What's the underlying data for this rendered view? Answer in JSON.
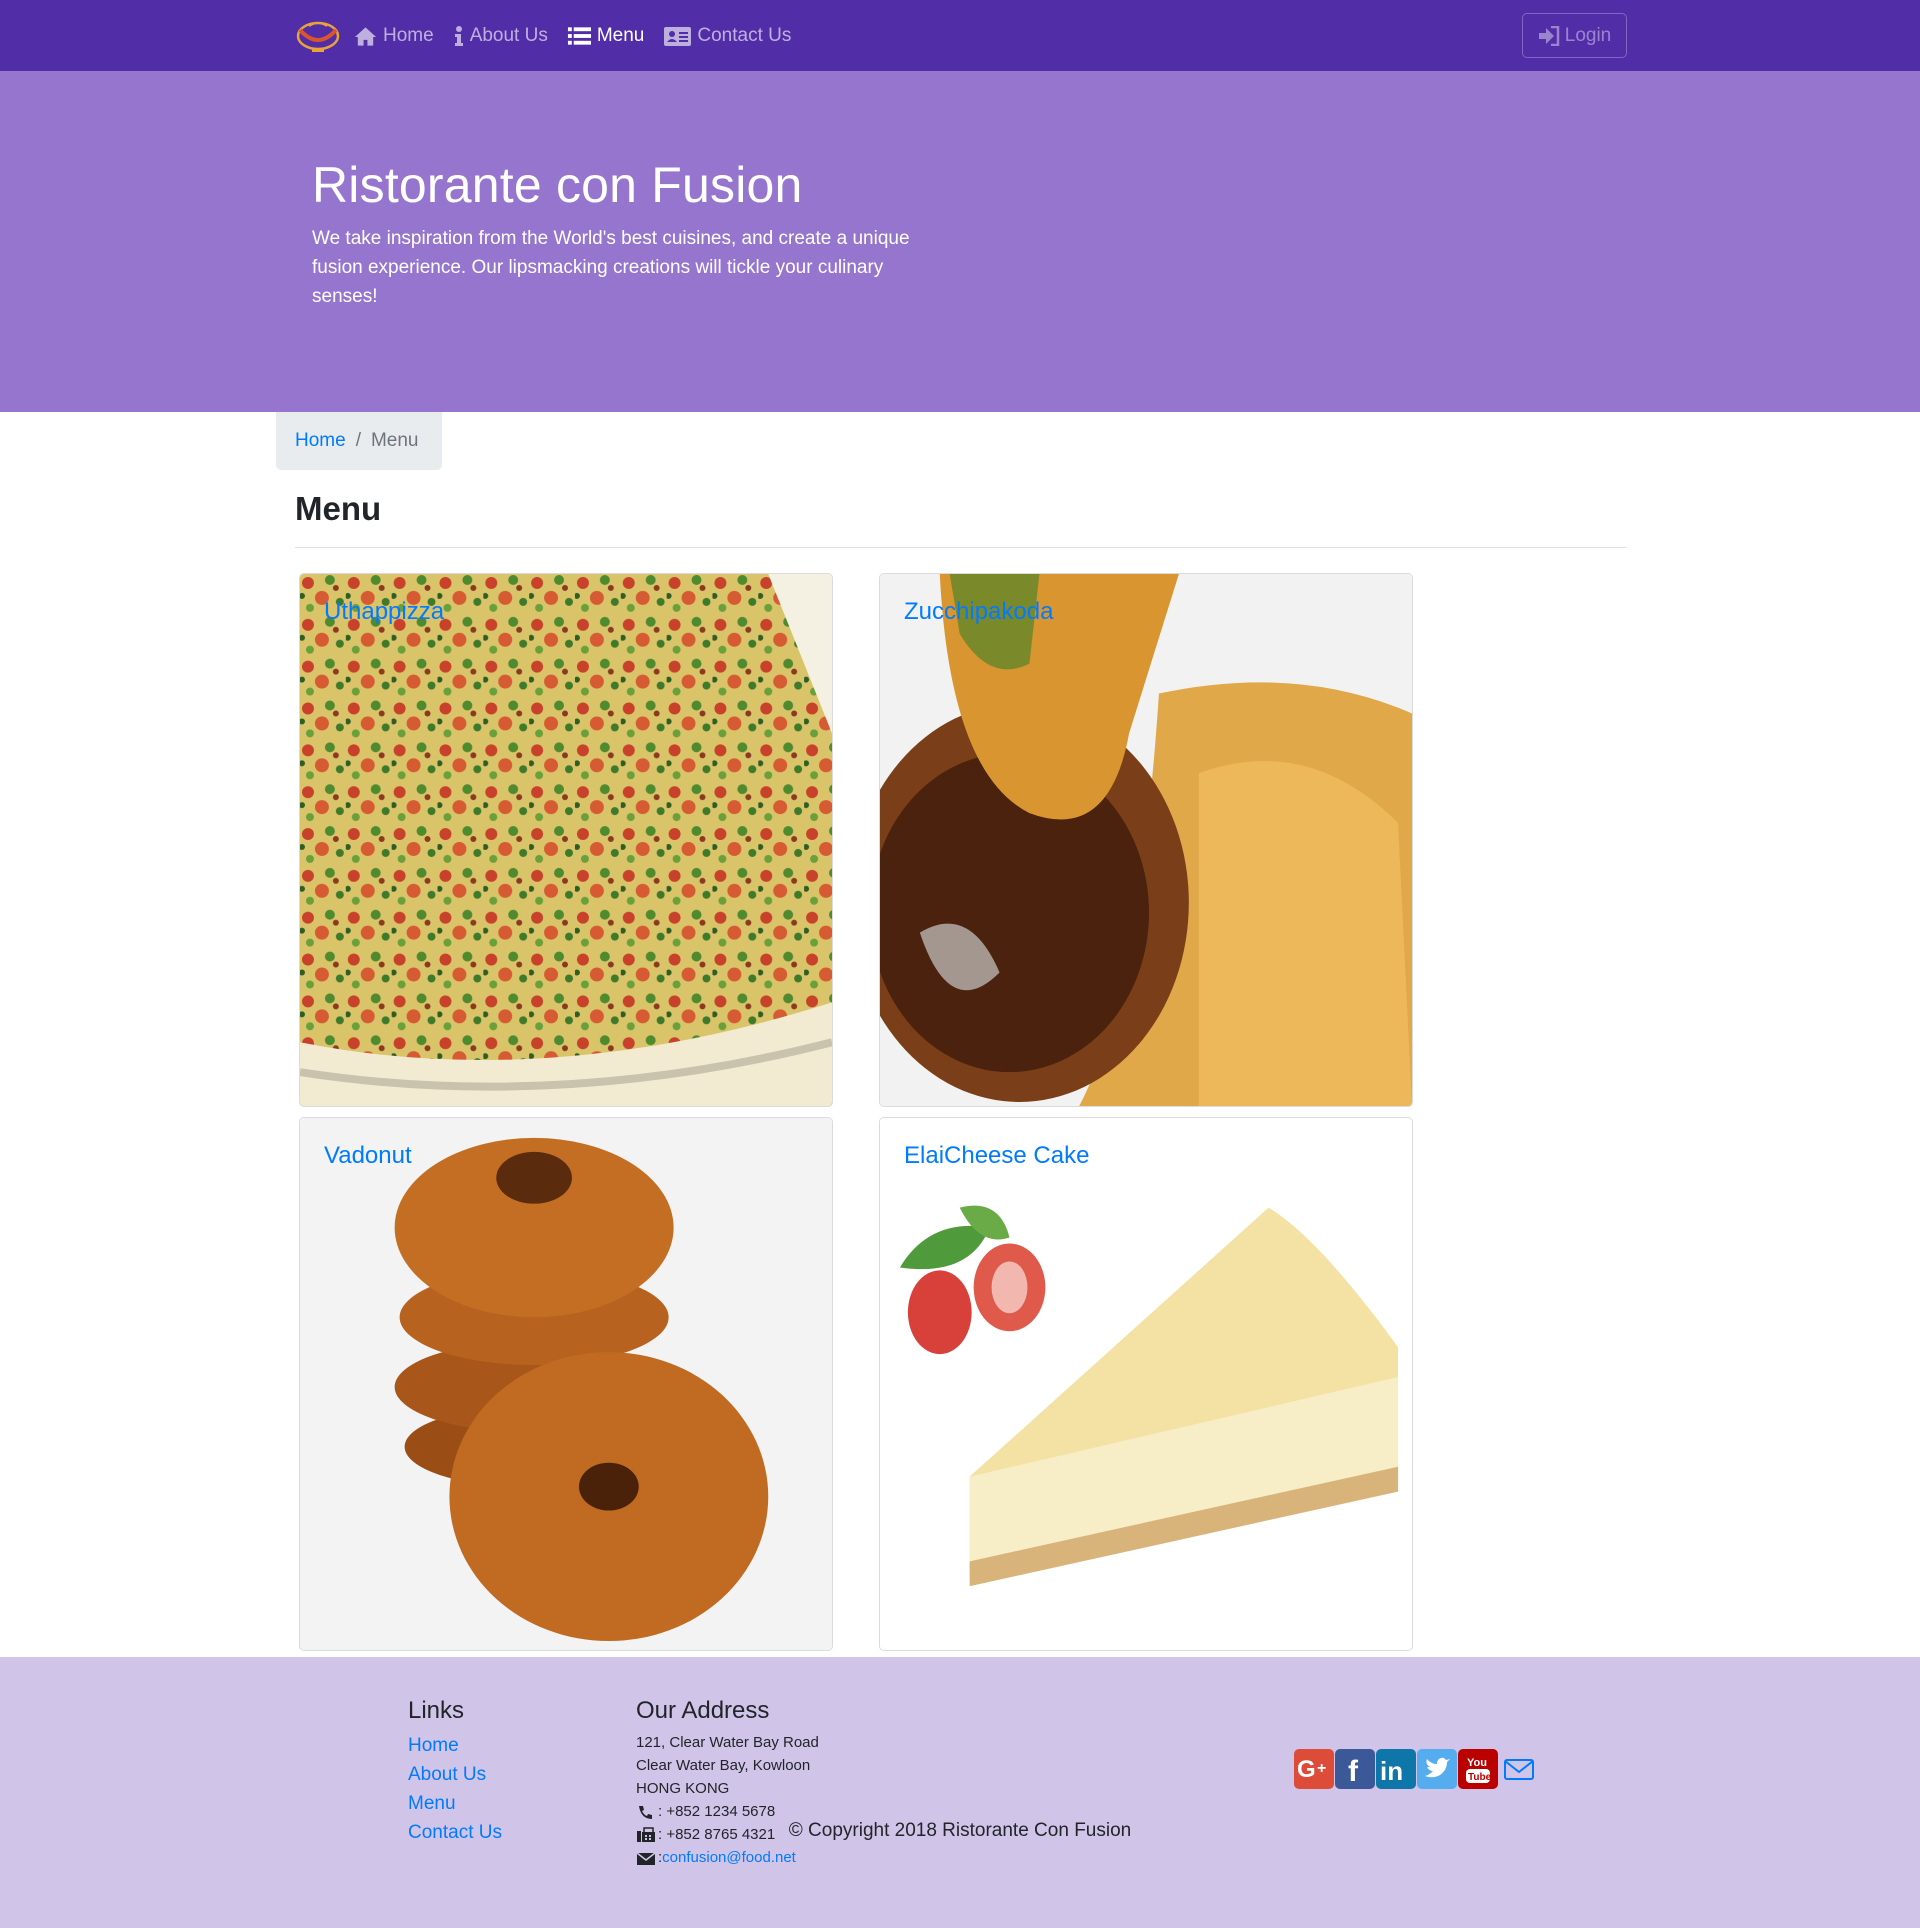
{
  "navbar": {
    "brand_logo": "confusion-logo",
    "items": [
      {
        "label": "Home",
        "icon": "home-icon",
        "active": false
      },
      {
        "label": "About Us",
        "icon": "info-icon",
        "active": false
      },
      {
        "label": "Menu",
        "icon": "list-icon",
        "active": true
      },
      {
        "label": "Contact Us",
        "icon": "address-card-icon",
        "active": false
      }
    ],
    "login_label": "Login",
    "login_icon": "sign-in-icon",
    "colors": {
      "background": "#512da8"
    }
  },
  "jumbotron": {
    "title": "Ristorante con Fusion",
    "text": "We take inspiration from the World's best cuisines, and create a unique fusion experience. Our lipsmacking creations will tickle your culinary senses!",
    "colors": {
      "background": "#9575cd"
    }
  },
  "breadcrumb": {
    "home": "Home",
    "separator": "/",
    "current": "Menu"
  },
  "menu": {
    "heading": "Menu",
    "dishes": [
      {
        "name": "Uthappizza",
        "image": "uthappizza-image"
      },
      {
        "name": "Zucchipakoda",
        "image": "zucchipakoda-image"
      },
      {
        "name": "Vadonut",
        "image": "vadonut-image"
      },
      {
        "name": "ElaiCheese Cake",
        "image": "elaicheese-cake-image"
      }
    ]
  },
  "footer": {
    "links_heading": "Links",
    "links": [
      "Home",
      "About Us",
      "Menu",
      "Contact Us"
    ],
    "address_heading": "Our Address",
    "address_lines": [
      "121, Clear Water Bay Road",
      "Clear Water Bay, Kowloon",
      "HONG KONG"
    ],
    "phone": ": +852 1234 5678",
    "fax": ": +852 8765 4321",
    "email_prefix": ":",
    "email": "confusion@food.net",
    "social": [
      "google-plus-icon",
      "facebook-icon",
      "linkedin-icon",
      "twitter-icon",
      "youtube-icon",
      "envelope-icon"
    ],
    "copyright": "© Copyright 2018 Ristorante Con Fusion",
    "colors": {
      "background": "#d1c4e9",
      "link": "#007bff"
    }
  }
}
